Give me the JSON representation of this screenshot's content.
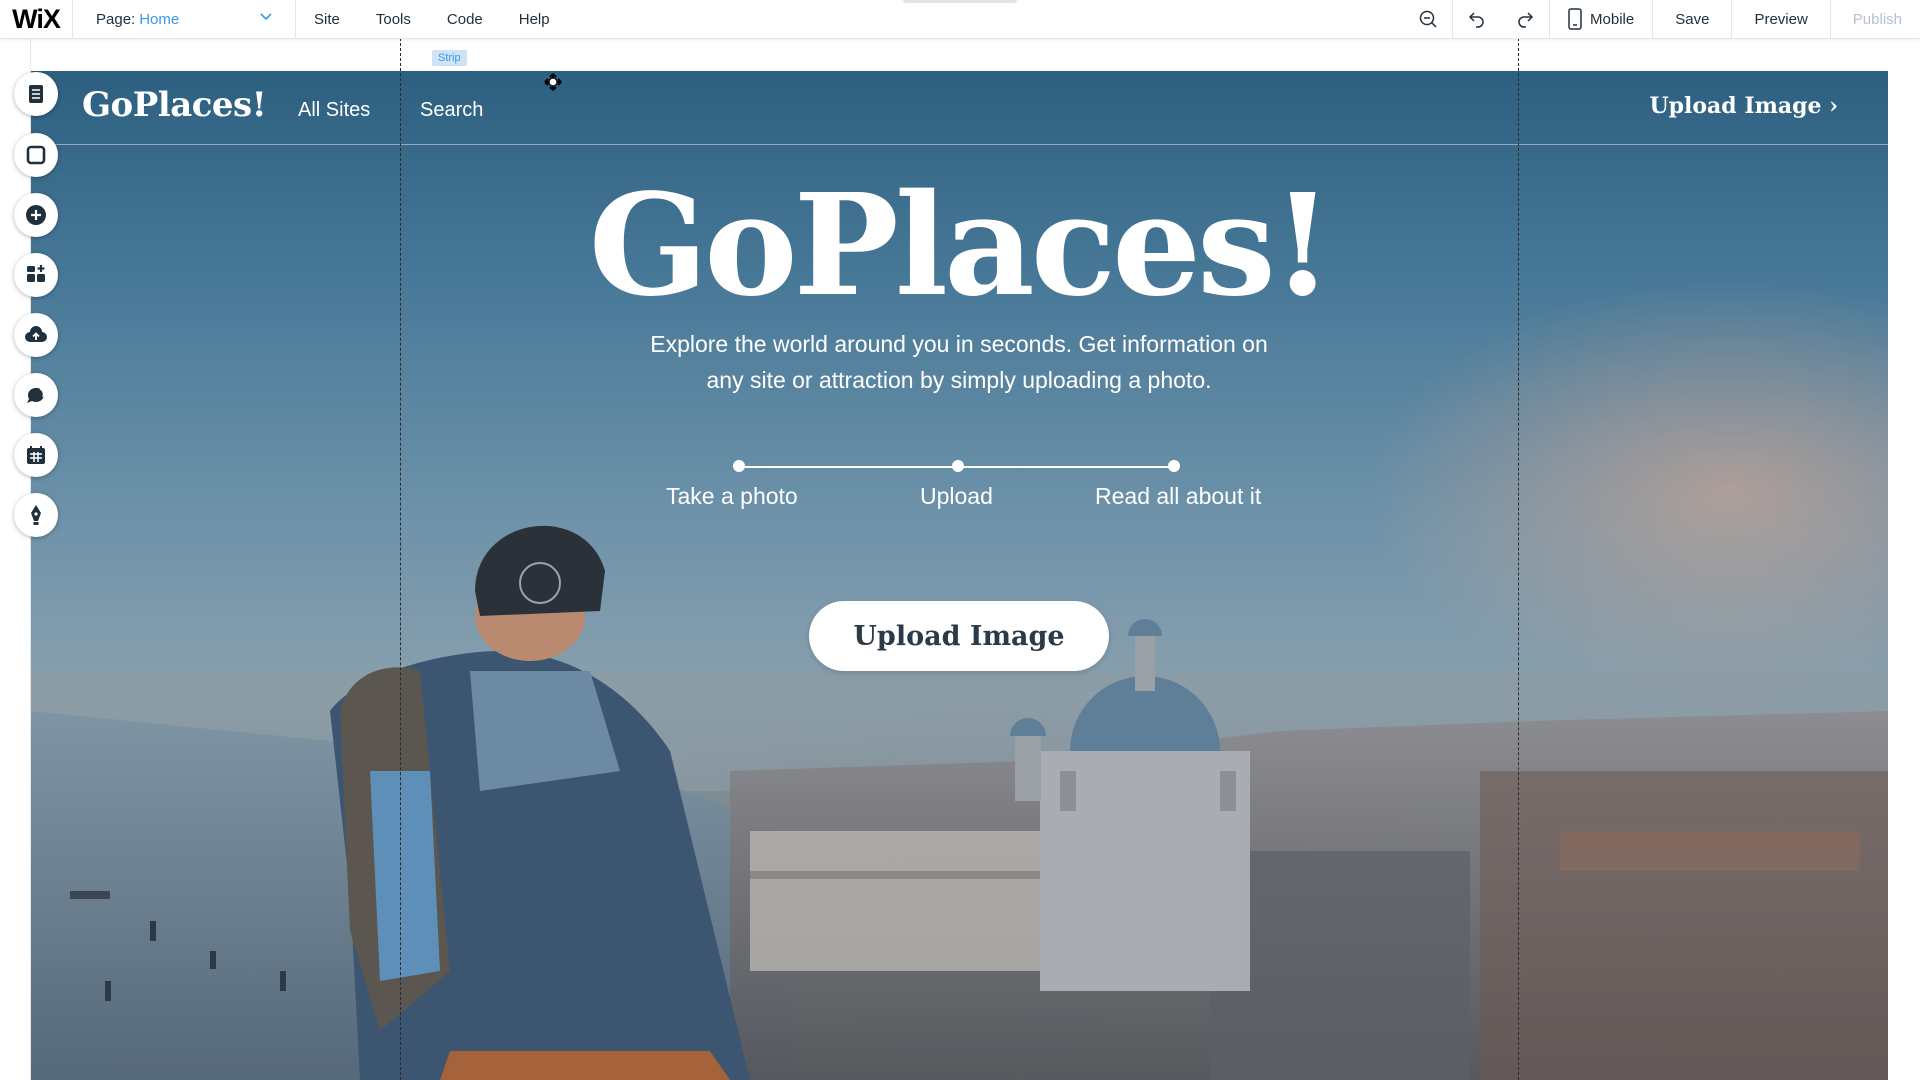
{
  "editor": {
    "logo": "WiX",
    "page_label": "Page:",
    "page_name": "Home",
    "menu": [
      "Site",
      "Tools",
      "Code",
      "Help"
    ],
    "mobile_label": "Mobile",
    "save_label": "Save",
    "preview_label": "Preview",
    "publish_label": "Publish",
    "strip_label": "Strip",
    "accent_color": "#3899ec"
  },
  "rail": {
    "items": [
      "pages-icon",
      "background-icon",
      "add-icon",
      "app-market-icon",
      "upload-icon",
      "chat-icon",
      "bookings-icon",
      "blog-pen-icon"
    ]
  },
  "site": {
    "logo": "GoPlaces!",
    "nav": [
      "All Sites",
      "Search"
    ],
    "header_upload": "Upload Image ›",
    "hero_title": "GoPlaces!",
    "hero_subtitle_line1": "Explore the world around you in seconds. Get information on",
    "hero_subtitle_line2": "any site or attraction by simply uploading a photo.",
    "steps": [
      "Take a photo",
      "Upload",
      "Read all about it"
    ],
    "cta_label": "Upload Image"
  }
}
